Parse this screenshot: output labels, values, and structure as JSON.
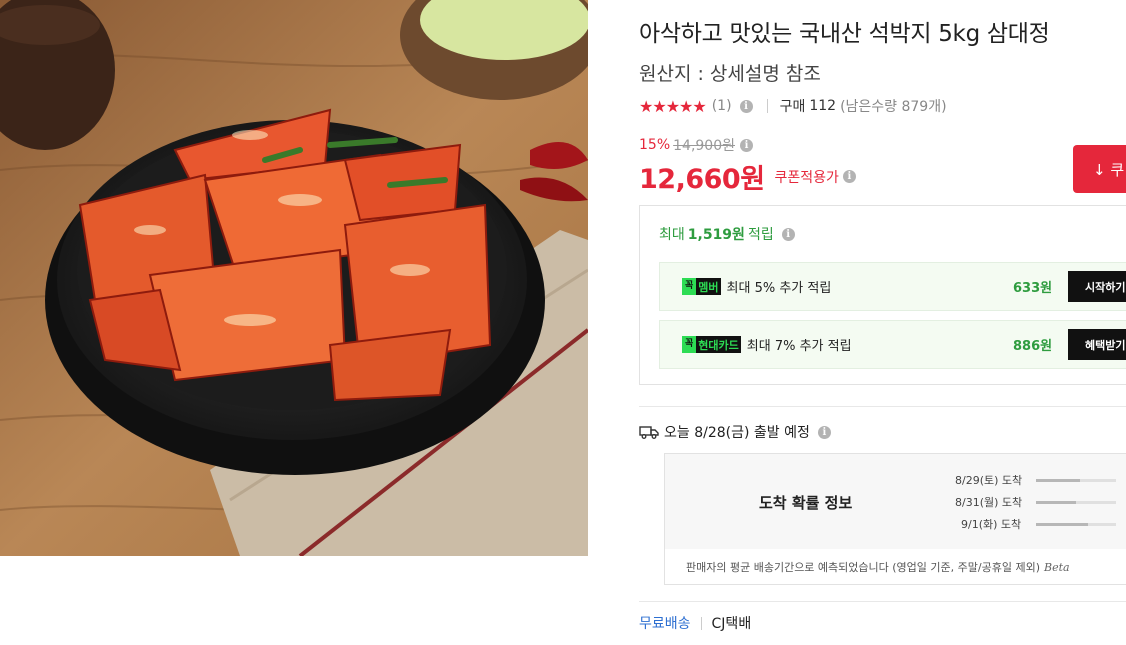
{
  "product": {
    "title": "아삭하고 맛있는 국내산 석박지 5kg 삼대정",
    "origin": "원산지 : 상세설명 참조",
    "image_subject": "kkakdugi-bowl-photo"
  },
  "rating": {
    "stars": "★★★★★",
    "star_value": 5,
    "review_count": "(1)",
    "purchase_label": "구매",
    "purchase_count": "112",
    "stock": "(남은수량 879개)"
  },
  "price": {
    "discount_rate": "15%",
    "original": "14,900원",
    "sale": "12,660원",
    "coupon_note": "쿠폰적용가",
    "coupon_button": "↓ 쿠"
  },
  "reward": {
    "head_prefix": "최대",
    "head_amount": "1,519원",
    "head_suffix": "적립",
    "rows": [
      {
        "badge": "멤버",
        "badge_check": "꼭",
        "desc": "최대 5% 추가 적립",
        "amount": "633원",
        "cta": "시작하기"
      },
      {
        "badge": "현대카드",
        "badge_check": "꼭",
        "desc": "최대 7% 추가 적립",
        "amount": "886원",
        "cta": "혜택받기"
      }
    ]
  },
  "shipping": {
    "departure": "오늘 8/28(금) 출발 예정",
    "arrival_title": "도착 확률 정보",
    "arrivals": [
      {
        "date": "8/29(토) 도착",
        "level": 0.55
      },
      {
        "date": "8/31(월) 도착",
        "level": 0.5
      },
      {
        "date": "9/1(화) 도착",
        "level": 0.65
      }
    ],
    "note": "판매자의 평균 배송기간으로 예측되었습니다 (영업일 기준, 주말/공휴일 제외)",
    "beta": "Beta",
    "free_shipping": "무료배송",
    "carrier": "CJ택배"
  },
  "colors": {
    "accent_red": "#e5273b",
    "reward_green": "#2e9c3f",
    "link_blue": "#2d6fd1"
  }
}
